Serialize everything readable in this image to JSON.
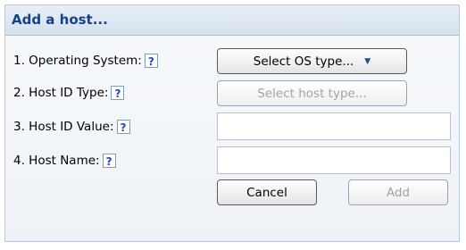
{
  "dialog": {
    "title": "Add a host..."
  },
  "rows": {
    "os": {
      "label": "1. Operating System:",
      "help": "?",
      "select_label": "Select OS type...",
      "arrow_icon": "▼"
    },
    "host_type": {
      "label": "2. Host ID Type:",
      "help": "?",
      "select_label": "Select host type..."
    },
    "host_id_value": {
      "label": "3. Host ID Value:",
      "help": "?",
      "value": ""
    },
    "host_name": {
      "label": "4. Host Name:",
      "help": "?",
      "value": ""
    }
  },
  "buttons": {
    "cancel": "Cancel",
    "add": "Add"
  }
}
